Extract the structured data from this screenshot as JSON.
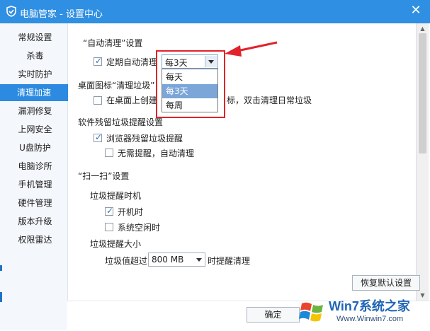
{
  "window": {
    "title": "电脑管家 - 设置中心",
    "close_glyph": "✕",
    "accent_color": "#2f8fe2"
  },
  "sidebar": {
    "items": [
      {
        "label": "常规设置"
      },
      {
        "label": "杀毒"
      },
      {
        "label": "实时防护"
      },
      {
        "label": "清理加速",
        "active": true
      },
      {
        "label": "漏洞修复"
      },
      {
        "label": "上网安全"
      },
      {
        "label": "U盘防护"
      },
      {
        "label": "电脑诊所"
      },
      {
        "label": "手机管理"
      },
      {
        "label": "硬件管理"
      },
      {
        "label": "版本升级"
      },
      {
        "label": "权限雷达"
      }
    ]
  },
  "auto_clean": {
    "heading": "“自动清理”设置",
    "checkbox_label": "定期自动清理",
    "checked": true,
    "dropdown_value": "每3天",
    "options": [
      "每天",
      "每3天",
      "每周"
    ],
    "selected_option": "每3天"
  },
  "desktop_icon": {
    "heading": "桌面图标“清理垃圾”",
    "checkbox_label_prefix": "在桌面上创建",
    "checkbox_label_suffix": "标，双击清理日常垃圾",
    "checked": false
  },
  "residual": {
    "heading": "软件残留垃圾提醒设置",
    "browser_label": "浏览器残留垃圾提醒",
    "browser_checked": true,
    "auto_label": "无需提醒，自动清理",
    "auto_checked": false
  },
  "scan": {
    "heading": "“扫一扫”设置",
    "timing_heading": "垃圾提醒时机",
    "boot_label": "开机时",
    "boot_checked": true,
    "idle_label": "系统空闲时",
    "idle_checked": false,
    "size_heading": "垃圾提醒大小",
    "size_prefix": "垃圾值超过",
    "size_value": "800 MB",
    "size_suffix": "时提醒清理"
  },
  "buttons": {
    "restore_default": "恢复默认设置",
    "ok": "确定"
  },
  "watermark": {
    "brand": "Win7系统之家",
    "url": "Www.Winwin7.com"
  }
}
